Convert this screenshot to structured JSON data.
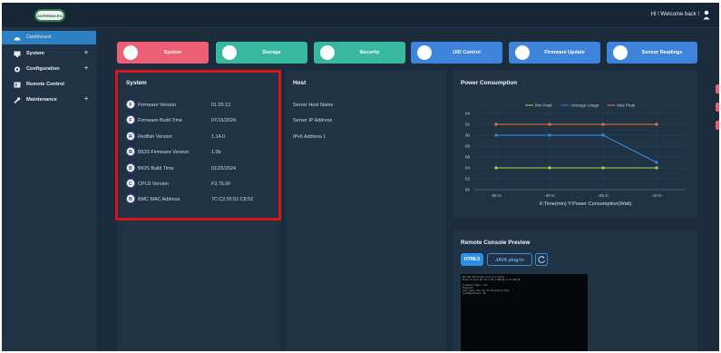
{
  "header": {
    "logo_text": "SUPERMICRO",
    "welcome_text": "Hi ! Welcome back !"
  },
  "sidebar": {
    "items": [
      {
        "label": "Dashboard",
        "icon": "dashboard-icon",
        "expandable": false,
        "active": true
      },
      {
        "label": "System",
        "icon": "monitor-icon",
        "expandable": true,
        "active": false
      },
      {
        "label": "Configuration",
        "icon": "gear-icon",
        "expandable": true,
        "active": false
      },
      {
        "label": "Remote Control",
        "icon": "remote-console-icon",
        "expandable": false,
        "active": false
      },
      {
        "label": "Maintenance",
        "icon": "wrench-icon",
        "expandable": true,
        "active": false
      }
    ],
    "plus_symbol": "+"
  },
  "tabs": [
    {
      "label": "System",
      "color": "#ec5f75",
      "icon": "system-icon"
    },
    {
      "label": "Storage",
      "color": "#38b99f",
      "icon": "storage-icon"
    },
    {
      "label": "Security",
      "color": "#38b99f",
      "icon": "security-icon"
    },
    {
      "label": "UID Control",
      "color": "#3f84dc",
      "icon": "link-icon"
    },
    {
      "label": "Firmware Update",
      "color": "#3f84dc",
      "icon": "link-icon"
    },
    {
      "label": "Sensor Readings",
      "color": "#3f84dc",
      "icon": "link-icon"
    }
  ],
  "system_panel": {
    "title": "System",
    "rows": [
      {
        "badge": "F",
        "label": "Firmware Version",
        "value": "01.03.13"
      },
      {
        "badge": "F",
        "label": "Firmware Build Time",
        "value": "07/15/2024"
      },
      {
        "badge": "R",
        "label": "Redfish Version",
        "value": "1.14.0"
      },
      {
        "badge": "B",
        "label": "BIOS Firmware Version",
        "value": "1.0b"
      },
      {
        "badge": "B",
        "label": "BIOS Build Time",
        "value": "01/25/2024"
      },
      {
        "badge": "C",
        "label": "CPLD Version",
        "value": "F3.76.0F"
      },
      {
        "badge": "B",
        "label": "BMC MAC Address",
        "value": "7C:C2:55:51:C8:52"
      }
    ]
  },
  "host_panel": {
    "title": "Host",
    "rows": [
      "Server Host Name",
      "Server IP Address",
      "IPv6 Address 1"
    ]
  },
  "power_panel": {
    "title": "Power Consumption"
  },
  "chart_data": {
    "type": "line",
    "title": "Power Consumption",
    "xlabel": "X:Time(min) Y:Power Consumption(Watt)",
    "ylabel": "",
    "categories": [
      "-55 m",
      "-40 m",
      "-25 m",
      "-10 m"
    ],
    "ylim": [
      80,
      94
    ],
    "yticks": [
      80,
      82,
      84,
      86,
      88,
      90,
      92,
      94
    ],
    "grid": true,
    "legend_position": "top",
    "series": [
      {
        "name": "Min Peak",
        "color": "#a7d94c",
        "values": [
          84,
          84,
          84,
          84
        ]
      },
      {
        "name": "Average Usage",
        "color": "#2f8fe6",
        "values": [
          90,
          90,
          90,
          85
        ]
      },
      {
        "name": "Max Peak",
        "color": "#e8763a",
        "values": [
          92,
          92,
          92,
          92
        ]
      }
    ]
  },
  "remote_console": {
    "title": "Remote Console Preview",
    "html5_label": "HTML5",
    "java_label": "JAVA plug-in",
    "refresh_icon": "refresh-icon",
    "screen_lines": [
      "Red Hat Enterprise Linux 9.4 (Plow)",
      "Kernel 5.14.0-427.13.1.el9_4.x86_64 on an x86_64",
      "",
      "localhost login: root",
      "Password:",
      "Last login: Mon Jul 15 10:12:07 on tty1",
      "[root@localhost ~]#"
    ]
  }
}
